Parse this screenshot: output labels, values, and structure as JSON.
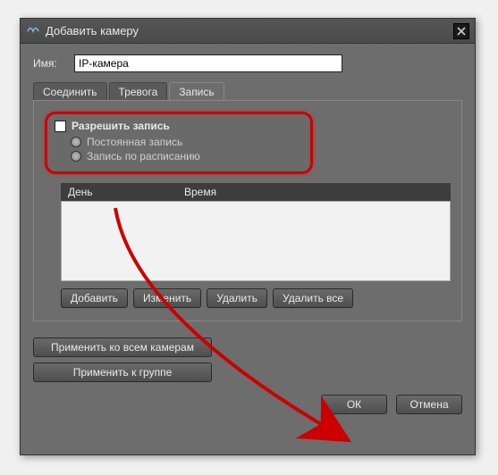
{
  "window": {
    "title": "Добавить камеру"
  },
  "name_field": {
    "label": "Имя:",
    "value": "IP-камера"
  },
  "tabs": {
    "connect": "Соединить",
    "alarm": "Тревога",
    "record": "Запись"
  },
  "record_panel": {
    "enable_label": "Разрешить запись",
    "mode_continuous": "Постоянная запись",
    "mode_schedule": "Запись по расписанию",
    "columns": {
      "day": "День",
      "time": "Время"
    },
    "buttons": {
      "add": "Добавить",
      "edit": "Изменить",
      "del": "Удалить",
      "del_all": "Удалить все"
    }
  },
  "apply": {
    "all_cams": "Применить ко всем камерам",
    "group": "Применить к группе"
  },
  "footer": {
    "ok": "ОК",
    "cancel": "Отмена"
  }
}
